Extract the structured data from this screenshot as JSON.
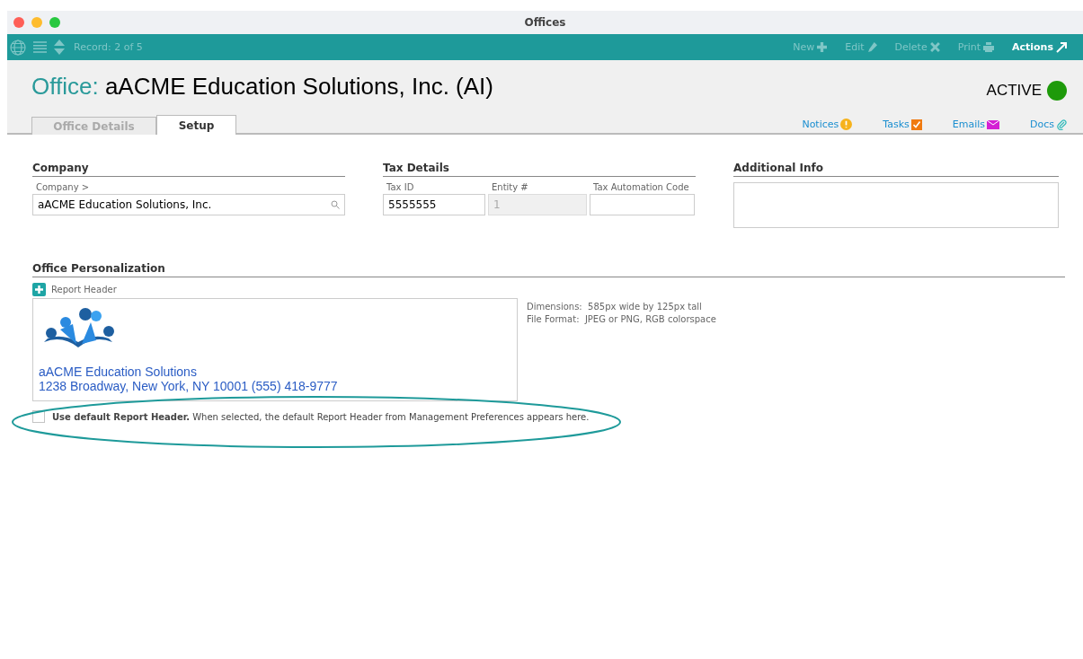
{
  "window": {
    "title": "Offices"
  },
  "toolbar": {
    "record": "Record: 2 of 5",
    "actions": [
      {
        "label": "New",
        "disabled": true
      },
      {
        "label": "Edit",
        "disabled": true
      },
      {
        "label": "Delete",
        "disabled": true
      },
      {
        "label": "Print",
        "disabled": true
      },
      {
        "label": "Actions",
        "disabled": false
      }
    ]
  },
  "header": {
    "prefix": "Office:",
    "name": "aACME Education Solutions, Inc.  (AI)",
    "status": "ACTIVE"
  },
  "tabs": [
    {
      "label": "Office Details",
      "selected": false
    },
    {
      "label": "Setup",
      "selected": true
    }
  ],
  "links": [
    {
      "label": "Notices"
    },
    {
      "label": "Tasks"
    },
    {
      "label": "Emails"
    },
    {
      "label": "Docs"
    }
  ],
  "company": {
    "title": "Company",
    "label": "Company >",
    "value": "aACME Education Solutions, Inc."
  },
  "tax": {
    "title": "Tax Details",
    "fields": [
      {
        "label": "Tax ID",
        "value": "5555555",
        "disabled": false
      },
      {
        "label": "Entity #",
        "value": "1",
        "disabled": true
      },
      {
        "label": "Tax Automation Code",
        "disabled": false
      }
    ]
  },
  "additional": {
    "title": "Additional Info"
  },
  "personalization": {
    "title": "Office Personalization",
    "add_label": "Report Header",
    "header_lines": [
      "aACME Education Solutions",
      "1238 Broadway, New York, NY 10001 (555) 418-9777"
    ],
    "specs": [
      {
        "label": "Dimensions:",
        "value": "585px wide by 125px tall"
      },
      {
        "label": "File Format:",
        "value": "JPEG or PNG, RGB colorspace"
      }
    ],
    "checkbox": {
      "checked": false,
      "text": "**Use default Report Header.** When selected, the default Report Header from Management Preferences appears here."
    }
  }
}
